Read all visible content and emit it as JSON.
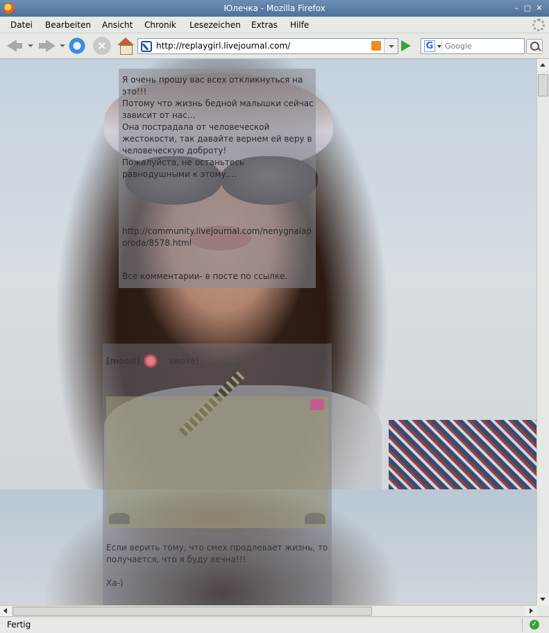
{
  "window": {
    "title": "Юлечка - Mozilla Firefox",
    "minimize_glyph": "–",
    "maximize_glyph": "□",
    "close_glyph": "✕"
  },
  "menu": {
    "items": [
      "Datei",
      "Bearbeiten",
      "Ansicht",
      "Chronik",
      "Lesezeichen",
      "Extras",
      "Hilfe"
    ]
  },
  "toolbar": {
    "url": "http://replaygirl.livejournal.com/",
    "search_placeholder": "Google",
    "search_engine_letter": "G",
    "stop_glyph": "×"
  },
  "page": {
    "post1_text": "Я очень прошу вас всех откликнуться на это!!!\nПотому что жизнь бедной малышки сейчас зависит от нас...\nОна пострадала от человеческой жестокости, так давайте вернем ей веру в человеческую доброту!\nПожалуйста, не останьтесь равнодушными к этому....",
    "post1_link": "http://community.livejournal.com/nenygnaiaporoda/8578.html",
    "post1_footer": "Все комментарии- в посте по ссылке.",
    "mood_label": "[mood]",
    "mood_value": "awake]",
    "post2_line1": "Если верить тому, что смех продлевает жизнь, то получается, что я буду вечна!!!",
    "post2_line2": "Ха-)"
  },
  "status": {
    "text": "Fertig",
    "ok_glyph": "✓"
  }
}
